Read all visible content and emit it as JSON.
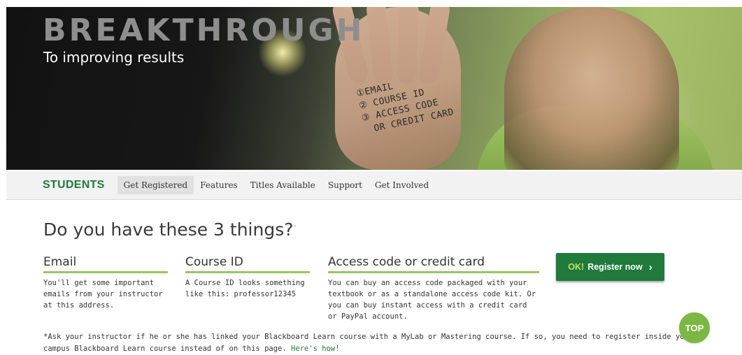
{
  "hero": {
    "title": "BREAKTHROUGH",
    "subtitle": "To improving results",
    "hand_notes": [
      "①EMAIL",
      "② COURSE ID",
      "③ ACCESS CODE",
      "OR CREDIT CARD"
    ]
  },
  "nav": {
    "brand": "STUDENTS",
    "items": [
      {
        "label": "Get Registered",
        "active": true
      },
      {
        "label": "Features",
        "active": false
      },
      {
        "label": "Titles Available",
        "active": false
      },
      {
        "label": "Support",
        "active": false
      },
      {
        "label": "Get Involved",
        "active": false
      }
    ]
  },
  "main": {
    "heading": "Do you have these 3 things?",
    "heading_mark": "*",
    "columns": [
      {
        "title": "Email",
        "text": "You'll get some important emails from your instructor at this address."
      },
      {
        "title": "Course ID",
        "text": "A Course ID looks something like this: professor12345"
      },
      {
        "title": "Access code or credit card",
        "text": "You can buy an access code packaged with your textbook or as a standalone access code kit. Or you can buy instant access with a credit card or PayPal account."
      }
    ],
    "register_button": {
      "ok": "OK!",
      "label": "Register now",
      "chevron": "›"
    },
    "note": "*Ask your instructor if he or she has linked your Blackboard Learn course with a MyLab or Mastering course. If so, you need to register inside your campus Blackboard Learn course instead of on this page.",
    "note_link": "Here's how!"
  },
  "top_button": {
    "label": "TOP"
  },
  "colors": {
    "brand_green": "#1e7a3a",
    "accent_green": "#9bc65a",
    "top_green": "#7bb843"
  }
}
